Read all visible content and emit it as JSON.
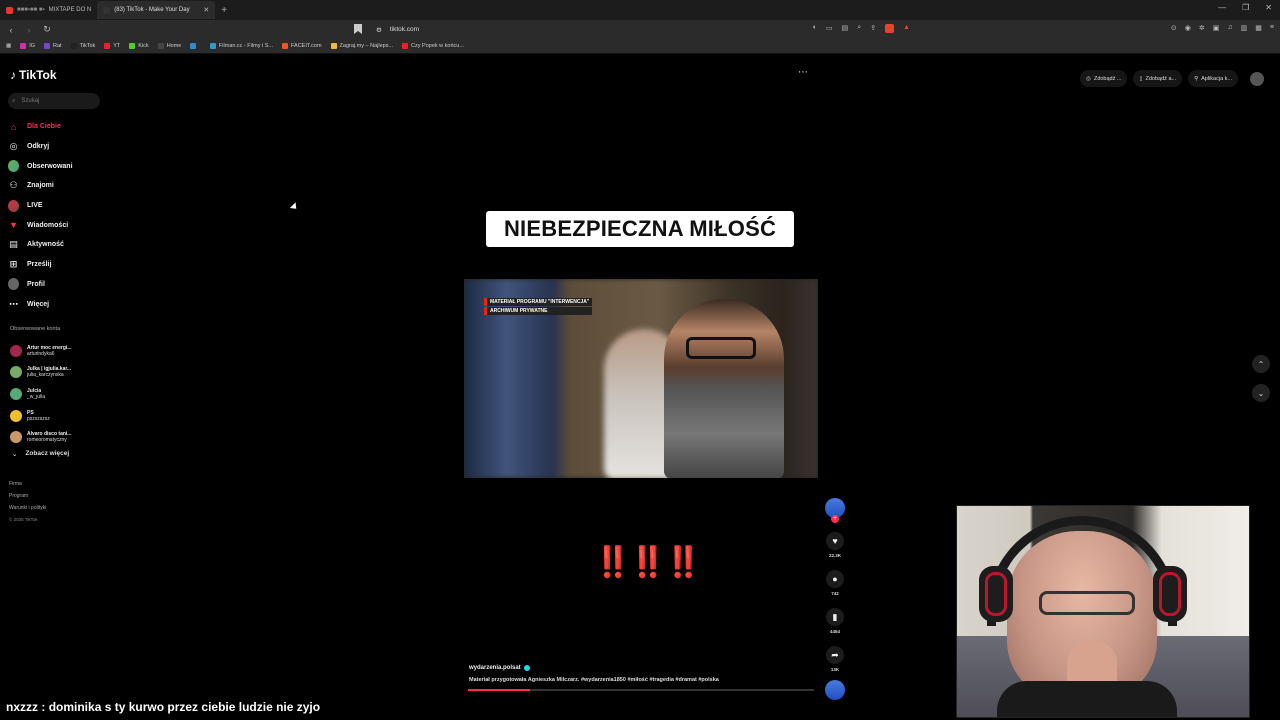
{
  "browser": {
    "tabs": [
      {
        "label": "MIXTAPE DO N"
      },
      {
        "label": "(83) TikTok - Make Your Day"
      }
    ],
    "address": "tiktok.com",
    "bookmarks": [
      "IG",
      "Rat",
      "TikTok",
      "YT",
      "Kick",
      "Home",
      "Filman.cc - Filmy i S...",
      "FACEIT.com",
      "Zagraj.my – Najleps...",
      "Czy Popek w końcu..."
    ]
  },
  "tiktok": {
    "logo": "TikTok",
    "search_placeholder": "Szukaj",
    "nav": [
      {
        "label": "Dla Ciebie",
        "icon": "home-icon"
      },
      {
        "label": "Odkryj",
        "icon": "compass-icon"
      },
      {
        "label": "Obserwowani",
        "icon": "avatar-icon"
      },
      {
        "label": "Znajomi",
        "icon": "friends-icon"
      },
      {
        "label": "LIVE",
        "icon": "live-icon"
      },
      {
        "label": "Wiadomości",
        "icon": "messages-icon"
      },
      {
        "label": "Aktywność",
        "icon": "activity-icon"
      },
      {
        "label": "Prześlij",
        "icon": "upload-icon"
      },
      {
        "label": "Profil",
        "icon": "profile-icon"
      },
      {
        "label": "Więcej",
        "icon": "more-icon"
      }
    ],
    "followed_title": "Obserwowane konta",
    "followed": [
      {
        "name": "Artur moc energi...",
        "handle": "arturindyka6"
      },
      {
        "name": "Julka | igjulia.kar...",
        "handle": "julia_karczynska"
      },
      {
        "name": "Julcia",
        "handle": "_w_julia"
      },
      {
        "name": "PS",
        "handle": "pszszszsz"
      },
      {
        "name": "Alvaro disco tani...",
        "handle": "romeoromatyczny"
      }
    ],
    "see_more": "Zobacz więcej",
    "footer": [
      "Firma",
      "Program",
      "Warunki i polityki"
    ],
    "copyright": "© 2025 TikTok",
    "top_buttons": [
      "Zdobądź ...",
      "Zdobądź a...",
      "Aplikacja k..."
    ]
  },
  "video": {
    "headline": "NIEBEZPIECZNA MIŁOŚĆ",
    "overlay_line1": "MATERIAŁ PROGRAMU \"INTERWENCJA\"",
    "overlay_line2": "ARCHIWUM PRYWATNE",
    "exclaim": "‼️‼️‼️",
    "author": "wydarzenia.polsat",
    "caption": "Materiał przygotowała Agnieszka Milczarz. #wydarzenia1850 #miłość #tragedia #dramat #polska",
    "likes": "22.3K",
    "comments": "742",
    "saves": "4454",
    "shares": "13K",
    "progress": 0.18
  },
  "stream_chat": {
    "user": "nxzzz",
    "message": "dominika s ty kurwo przez ciebie ludzie nie zyjo"
  },
  "colors": {
    "accent": "#fe2c55",
    "exclaim": "#e21818"
  }
}
